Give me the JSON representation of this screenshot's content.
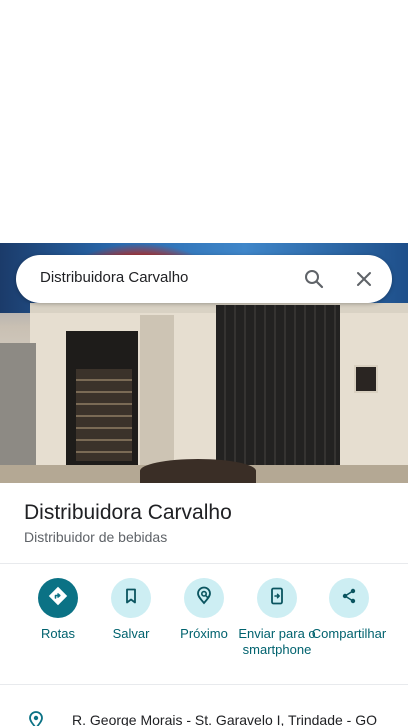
{
  "search": {
    "query": "Distribuidora Carvalho",
    "icons": [
      "search-icon",
      "close-icon"
    ]
  },
  "place": {
    "name": "Distribuidora Carvalho",
    "category": "Distribuidor de bebidas"
  },
  "actions": [
    {
      "label": "Rotas",
      "icon": "directions-icon",
      "primary": true
    },
    {
      "label": "Salvar",
      "icon": "bookmark-icon",
      "primary": false
    },
    {
      "label": "Próximo",
      "icon": "nearby-icon",
      "primary": false
    },
    {
      "label": "Enviar para o smartphone",
      "icon": "send-to-phone-icon",
      "primary": false
    },
    {
      "label": "Compartilhar",
      "icon": "share-icon",
      "primary": false
    }
  ],
  "address": {
    "text": "R. George Morais - St. Garavelo I, Trindade - GO",
    "icon": "location-pin-icon"
  },
  "colors": {
    "accent": "#0b7285",
    "action_bg": "#cdeef3",
    "label": "#00626e",
    "text_primary": "#202124",
    "text_secondary": "#5f6368"
  }
}
